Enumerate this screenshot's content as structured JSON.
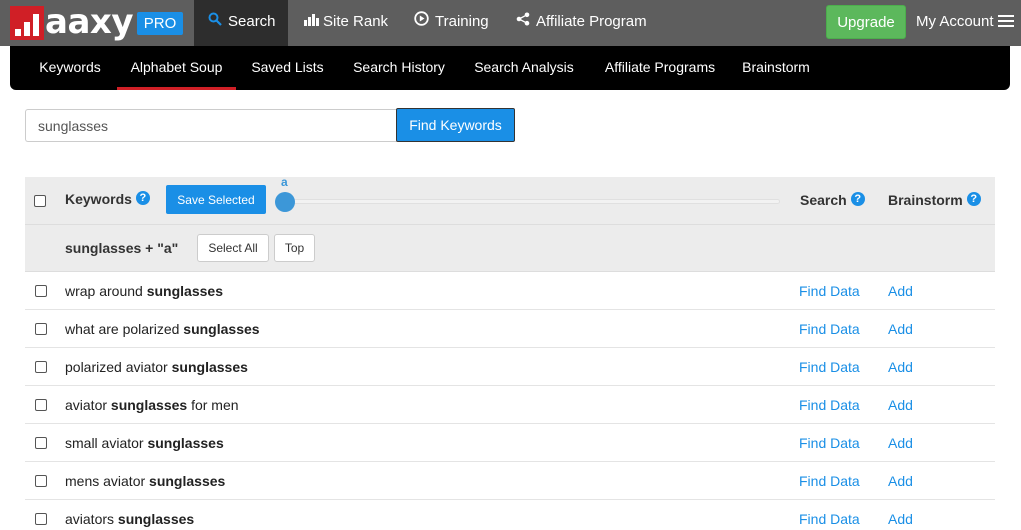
{
  "brand": {
    "logo_text": "aaxy",
    "pro_badge": "PRO",
    "colors": {
      "brand_red": "#d01f26",
      "accent_blue": "#1a8fe6",
      "upgrade_green": "#5cb85c"
    }
  },
  "topnav": {
    "items": [
      {
        "label": "Search",
        "icon": "search-icon",
        "active": true
      },
      {
        "label": "Site Rank",
        "icon": "bar-chart-icon",
        "active": false
      },
      {
        "label": "Training",
        "icon": "play-circle-icon",
        "active": false
      },
      {
        "label": "Affiliate Program",
        "icon": "share-icon",
        "active": false
      }
    ],
    "upgrade_label": "Upgrade",
    "account_label": "My Account",
    "menu_icon": "hamburger-icon"
  },
  "subnav": {
    "items": [
      {
        "label": "Keywords",
        "active": false
      },
      {
        "label": "Alphabet Soup",
        "active": true
      },
      {
        "label": "Saved Lists",
        "active": false
      },
      {
        "label": "Search History",
        "active": false
      },
      {
        "label": "Search Analysis",
        "active": false
      },
      {
        "label": "Affiliate Programs",
        "active": false
      },
      {
        "label": "Brainstorm",
        "active": false
      }
    ]
  },
  "search": {
    "value": "sunglasses",
    "button_label": "Find Keywords"
  },
  "table": {
    "keywords_header": "Keywords",
    "help_glyph": "?",
    "save_selected_label": "Save Selected",
    "slider_letter": "a",
    "search_header": "Search",
    "brainstorm_header": "Brainstorm",
    "group_title": "sunglasses + \"a\"",
    "select_all_label": "Select All",
    "top_label": "Top",
    "find_data_label": "Find Data",
    "add_label": "Add",
    "rows": [
      {
        "before": "wrap around ",
        "bold": "sunglasses",
        "after": ""
      },
      {
        "before": "what are polarized ",
        "bold": "sunglasses",
        "after": ""
      },
      {
        "before": "polarized aviator ",
        "bold": "sunglasses",
        "after": ""
      },
      {
        "before": "aviator ",
        "bold": "sunglasses",
        "after": " for men"
      },
      {
        "before": "small aviator ",
        "bold": "sunglasses",
        "after": ""
      },
      {
        "before": "mens aviator ",
        "bold": "sunglasses",
        "after": ""
      },
      {
        "before": "aviators ",
        "bold": "sunglasses",
        "after": ""
      }
    ]
  }
}
